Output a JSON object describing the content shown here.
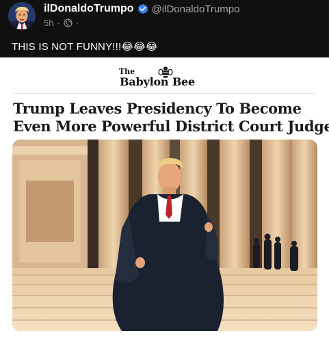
{
  "post": {
    "author_name": "ilDonaldoTrumpo",
    "author_handle": "@ilDonaldoTrumpo",
    "time": "5h",
    "separator": "·",
    "trailing_dot": "·",
    "text": "THIS IS NOT FUNNY!!!😂😂😂",
    "icons": {
      "verified": "verified-badge-icon",
      "privacy": "globe-icon",
      "avatar": "profile-avatar"
    },
    "colors": {
      "verified": "#3b82f6",
      "background": "#101010"
    }
  },
  "card": {
    "logo_the": "The",
    "logo_name": "Babylon Bee",
    "headline_line1": "Trump Leaves Presidency To Become",
    "headline_line2": "Even More Powerful District Court Judge",
    "image": "trump-in-judicial-robe-on-courthouse-steps"
  }
}
